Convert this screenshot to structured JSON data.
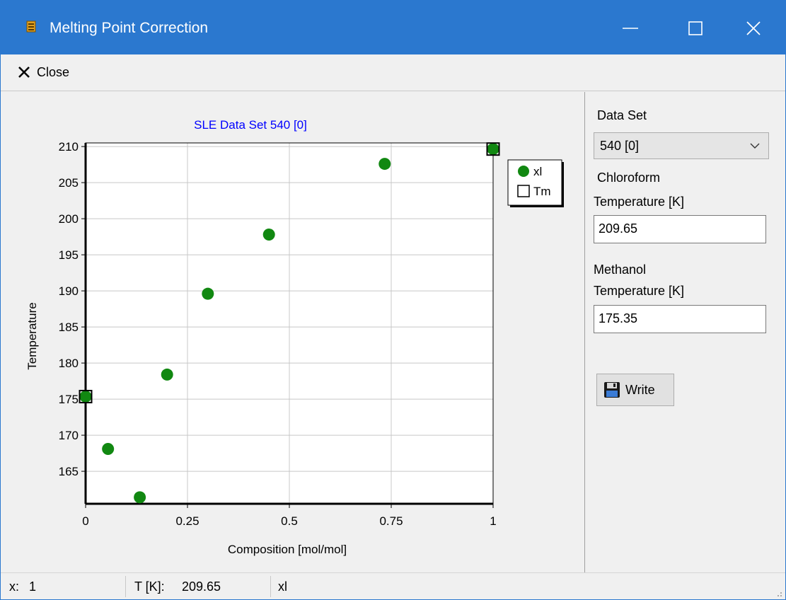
{
  "window": {
    "title": "Melting Point Correction",
    "accent_color": "#2b78cf",
    "controls": [
      "minimize-icon",
      "maximize-icon",
      "close-icon"
    ]
  },
  "toolbar": {
    "close_label": "Close",
    "close_icon": "close-x-icon"
  },
  "side_panel": {
    "data_set_label": "Data Set",
    "data_set_value": "540 [0]",
    "component1_name": "Chloroform",
    "component1_temp_label": "Temperature [K]",
    "component1_temp_value": "209.65",
    "component2_name": "Methanol",
    "component2_temp_label": "Temperature [K]",
    "component2_temp_value": "175.35",
    "write_label": "Write",
    "write_icon": "floppy-disk-icon"
  },
  "status_bar": {
    "x_label": "x:",
    "x_value": "1",
    "t_label": "T [K]:",
    "t_value": "209.65",
    "series": "xl"
  },
  "chart_data": {
    "type": "scatter",
    "title": "SLE Data Set 540 [0]",
    "xlabel": "Composition [mol/mol]",
    "ylabel": "Temperature",
    "xlim": [
      0,
      1
    ],
    "ylim": [
      160.5,
      210.5
    ],
    "xticks": [
      "0",
      "0.25",
      "0.5",
      "0.75",
      "1"
    ],
    "yticks": [
      "210",
      "205",
      "200",
      "195",
      "190",
      "185",
      "180",
      "175",
      "170",
      "165"
    ],
    "grid": true,
    "legend_position": "right",
    "title_color": "#0000ff",
    "series": [
      {
        "name": "xl",
        "marker": "circle",
        "color": "#118811",
        "x": [
          0,
          0.055,
          0.133,
          0.2,
          0.3,
          0.45,
          0.734,
          1
        ],
        "y": [
          175.35,
          168.1,
          161.4,
          178.4,
          189.6,
          197.8,
          207.6,
          209.65
        ]
      },
      {
        "name": "Tm",
        "marker": "square",
        "color": "#000000",
        "x": [
          0,
          1
        ],
        "y": [
          175.35,
          209.65
        ]
      }
    ]
  }
}
